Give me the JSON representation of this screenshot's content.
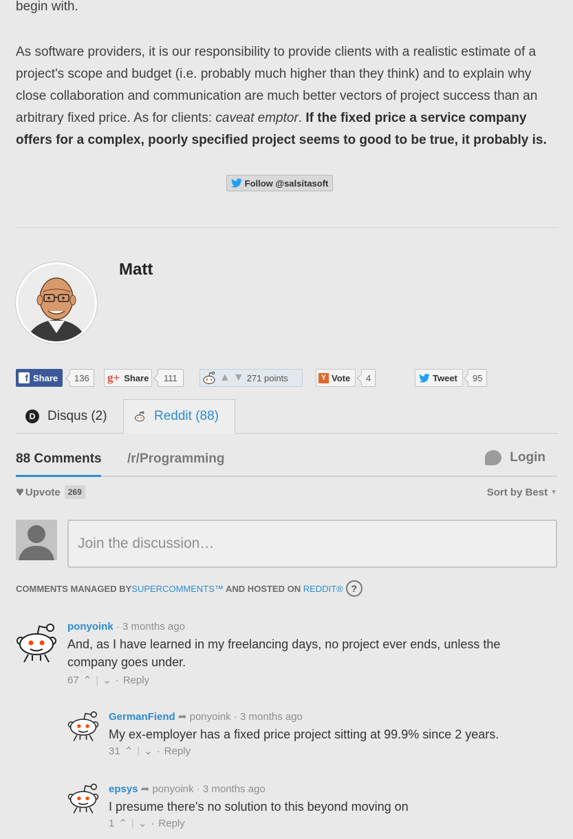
{
  "article": {
    "top_fragment": "begin with.",
    "para_start": "As software providers, it is our responsibility to provide clients with a realistic estimate of a project's scope and budget (i.e. probably much higher than they think) and to explain why close collaboration and communication are much better vectors of project success than an arbitrary fixed price. As for clients: ",
    "para_italic": "caveat emptor",
    "para_dot": ". ",
    "para_bold": "If the fixed price a service company offers for a complex, poorly specified project seems to good to be true, it probably is."
  },
  "follow_button": "Follow @salsitasoft",
  "author": {
    "name": "Matt"
  },
  "share": {
    "facebook": {
      "label": "Share",
      "count": "136"
    },
    "google": {
      "label": "Share",
      "count": "111"
    },
    "reddit": {
      "points": "271 points"
    },
    "hn": {
      "label": "Vote",
      "count": "4"
    },
    "twitter": {
      "label": "Tweet",
      "count": "95"
    }
  },
  "tabs": [
    {
      "label": "Disqus (2)"
    },
    {
      "label": "Reddit (88)"
    }
  ],
  "comments_bar": {
    "count_label": "88 Comments",
    "subreddit": "/r/Programming",
    "login": "Login"
  },
  "upvote": {
    "label": "Upvote",
    "count": "269"
  },
  "sort": {
    "label": "Sort by Best"
  },
  "input": {
    "placeholder": "Join the discussion…"
  },
  "managed": {
    "part1": "COMMENTS MANAGED BY ",
    "link1": "SUPERCOMMENTS™",
    "part2": " AND HOSTED ON ",
    "link2": "REDDIT®",
    "help": "?"
  },
  "comments": [
    {
      "author": "ponyoink",
      "time": "3 months ago",
      "text": "And, as I have learned in my freelancing days, no project ever ends, unless the company goes under.",
      "score": "67",
      "reply": "Reply"
    },
    {
      "author": "GermanFiend",
      "parent": "ponyoink",
      "time": "3 months ago",
      "text": "My ex-employer has a fixed price project sitting at 99.9% since 2 years.",
      "score": "31",
      "reply": "Reply"
    },
    {
      "author": "epsys",
      "parent": "ponyoink",
      "time": "3 months ago",
      "text": "I presume there's no solution to this beyond moving on",
      "score": "1",
      "reply": "Reply"
    }
  ],
  "separator": "·",
  "colors": {
    "accent": "#2e8bd0",
    "background": "#e9e9e9",
    "facebook": "#3b5998",
    "reddit_orange": "#ff4500",
    "hn_orange": "#e0692a"
  }
}
